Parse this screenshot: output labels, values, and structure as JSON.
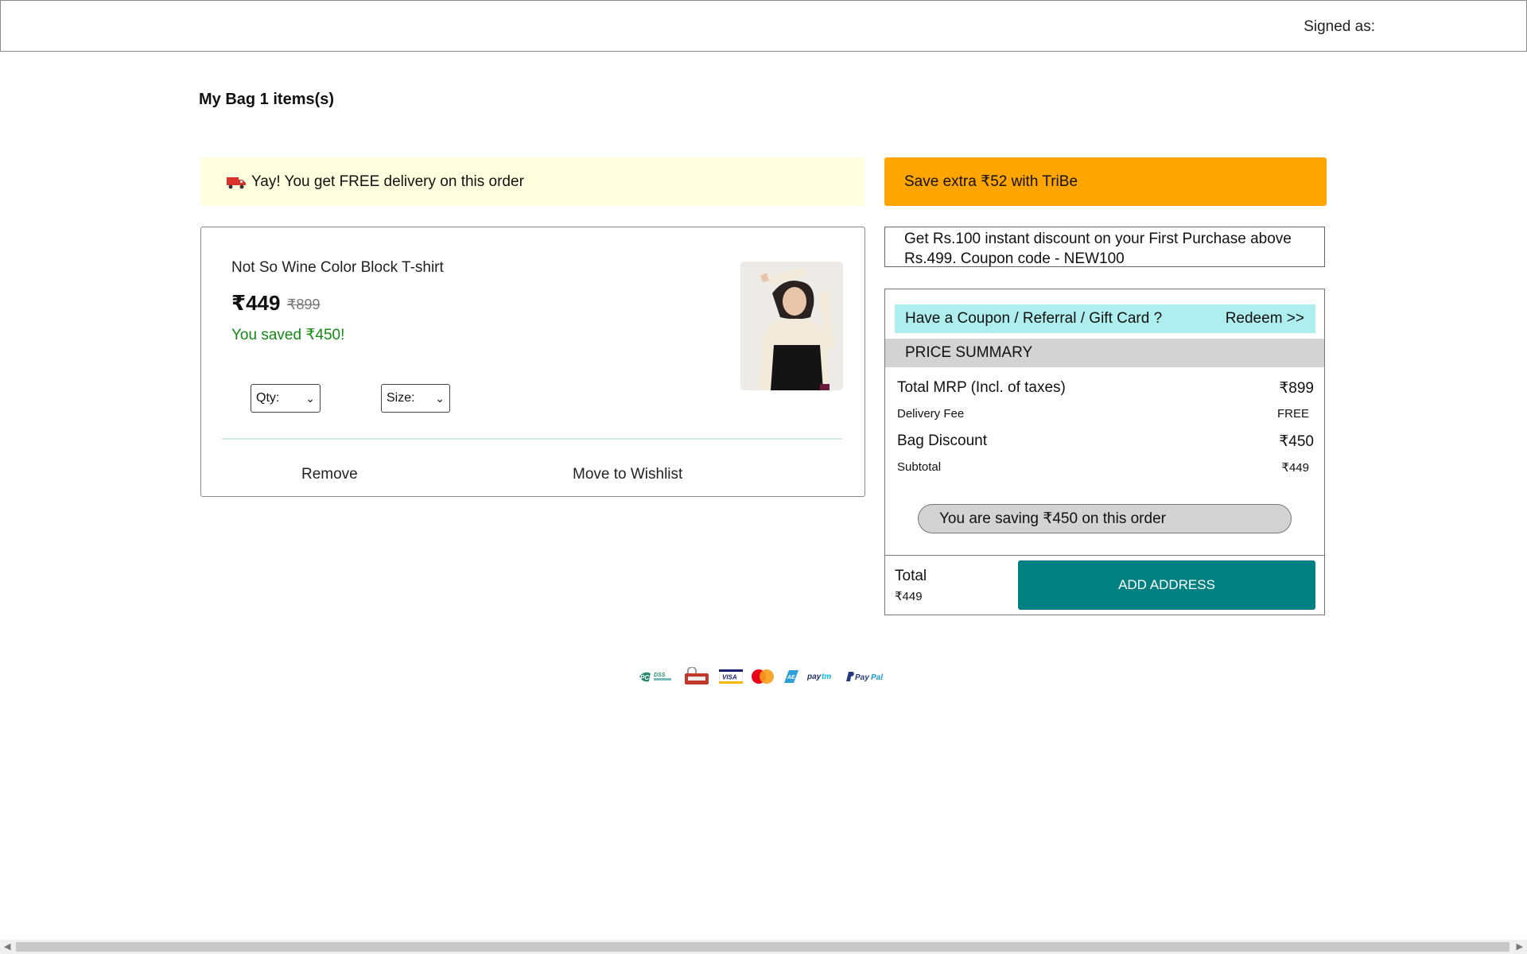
{
  "header": {
    "signed_as": "Signed as:"
  },
  "bag": {
    "title": "My Bag 1 items(s)"
  },
  "delivery_banner": {
    "text": "Yay! You get FREE delivery on this order",
    "icon": "truck-icon"
  },
  "tribe_banner": {
    "text": "Save extra ₹52 with TriBe",
    "color": "#ffa500"
  },
  "item": {
    "name": "Not So Wine Color Block T-shirt",
    "price": "₹449",
    "mrp": "₹899",
    "saved": "You saved ₹450!",
    "qty_label": "Qty:",
    "size_label": "Size:",
    "remove_label": "Remove",
    "wishlist_label": "Move to Wishlist"
  },
  "offer": {
    "text": "Get Rs.100 instant discount on your First Purchase above Rs.499. Coupon code - NEW100"
  },
  "coupon": {
    "label": "Have a Coupon / Referral / Gift Card ?",
    "action": "Redeem >>"
  },
  "price_summary": {
    "heading": "PRICE SUMMARY",
    "rows": [
      {
        "label": "Total MRP (Incl. of taxes)",
        "value": "₹899"
      },
      {
        "label": "Delivery Fee",
        "value": "FREE"
      },
      {
        "label": "Bag Discount",
        "value": "₹450"
      },
      {
        "label": "Subtotal",
        "value": "₹449"
      }
    ],
    "saving_text": "You are saving ₹450 on this order",
    "total_label": "Total",
    "total_value": "₹449",
    "add_address": "ADD ADDRESS"
  },
  "payments": [
    "PCI DSS",
    "secure",
    "VISA",
    "mastercard",
    "AE",
    "paytm",
    "PayPal"
  ],
  "colors": {
    "accent": "#008080",
    "coupon_bg": "#afeeee",
    "delivery_bg": "#ffffe0",
    "saved_text": "#138a13"
  }
}
